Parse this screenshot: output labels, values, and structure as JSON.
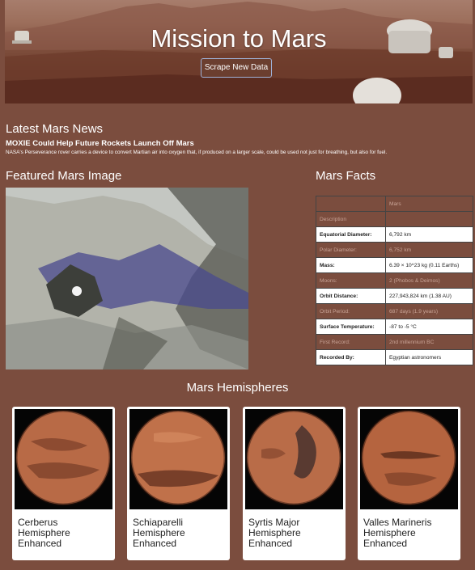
{
  "header": {
    "title": "Mission to Mars",
    "scrape_button": "Scrape New Data"
  },
  "news": {
    "heading": "Latest Mars News",
    "title": "MOXIE Could Help Future Rockets Launch Off Mars",
    "paragraph": "NASA's Perseverance rover carries a device to convert Martian air into oxygen that, if produced on a larger scale, could be used not just for breathing, but also for fuel."
  },
  "featured": {
    "heading": "Featured Mars Image"
  },
  "facts": {
    "heading": "Mars Facts",
    "columns": [
      "",
      "Mars"
    ],
    "rows": [
      {
        "label": "Description",
        "value": ""
      },
      {
        "label": "Equatorial Diameter:",
        "value": "6,792 km"
      },
      {
        "label": "Polar Diameter:",
        "value": "6,752 km"
      },
      {
        "label": "Mass:",
        "value": "6.39 × 10^23 kg (0.11 Earths)"
      },
      {
        "label": "Moons:",
        "value": "2 (Phobos & Deimos)"
      },
      {
        "label": "Orbit Distance:",
        "value": "227,943,824 km (1.38 AU)"
      },
      {
        "label": "Orbit Period:",
        "value": "687 days (1.9 years)"
      },
      {
        "label": "Surface Temperature:",
        "value": "-87 to -5 °C"
      },
      {
        "label": "First Record:",
        "value": "2nd millennium BC"
      },
      {
        "label": "Recorded By:",
        "value": "Egyptian astronomers"
      }
    ]
  },
  "hemispheres": {
    "heading": "Mars Hemispheres",
    "items": [
      {
        "title": "Cerberus Hemisphere Enhanced"
      },
      {
        "title": "Schiaparelli Hemisphere Enhanced"
      },
      {
        "title": "Syrtis Major Hemisphere Enhanced"
      },
      {
        "title": "Valles Marineris Hemisphere Enhanced"
      }
    ]
  }
}
